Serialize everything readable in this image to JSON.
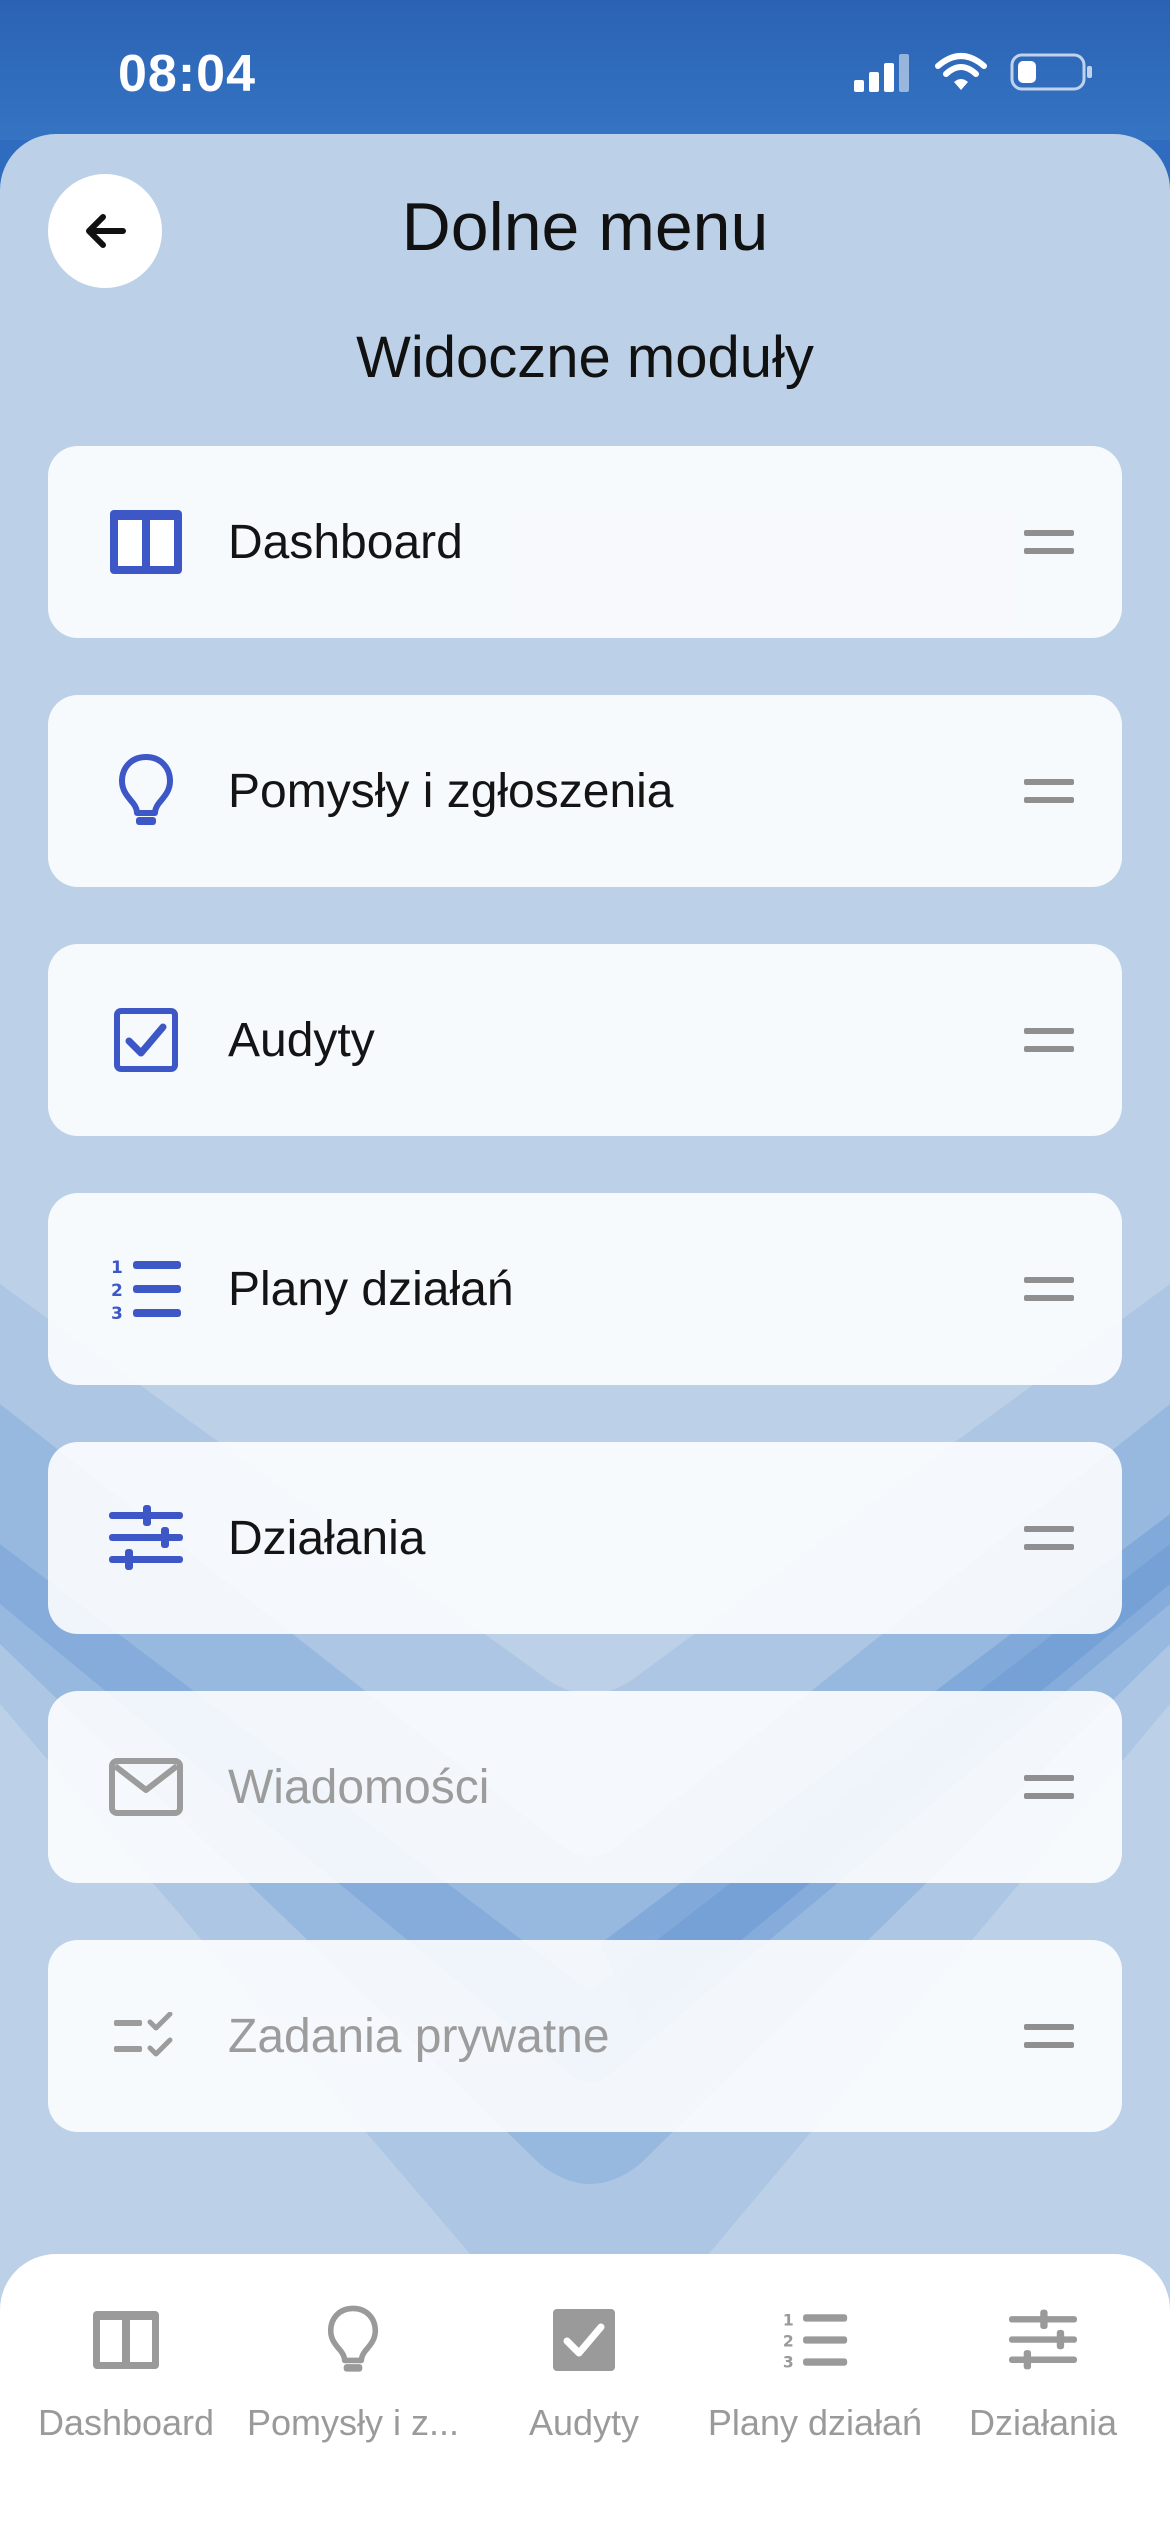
{
  "status_bar": {
    "time": "08:04",
    "icons": [
      "signal-icon",
      "wifi-icon",
      "battery-icon"
    ]
  },
  "header": {
    "back_icon": "arrow-left-icon",
    "title": "Dolne menu",
    "subtitle": "Widoczne moduły"
  },
  "modules": [
    {
      "label": "Dashboard",
      "icon": "dashboard-columns-icon",
      "enabled": true
    },
    {
      "label": "Pomysły i zgłoszenia",
      "icon": "lightbulb-icon",
      "enabled": true
    },
    {
      "label": "Audyty",
      "icon": "checkbox-icon",
      "enabled": true
    },
    {
      "label": "Plany działań",
      "icon": "numbered-list-icon",
      "enabled": true
    },
    {
      "label": "Działania",
      "icon": "sliders-icon",
      "enabled": true
    },
    {
      "label": "Wiadomości",
      "icon": "envelope-icon",
      "enabled": false
    },
    {
      "label": "Zadania prywatne",
      "icon": "checklist-icon",
      "enabled": false
    }
  ],
  "bottom_nav": [
    {
      "label": "Dashboard",
      "icon": "dashboard-columns-icon"
    },
    {
      "label": "Pomysły i z...",
      "icon": "lightbulb-icon"
    },
    {
      "label": "Audyty",
      "icon": "checkbox-icon"
    },
    {
      "label": "Plany działań",
      "icon": "numbered-list-icon"
    },
    {
      "label": "Działania",
      "icon": "sliders-icon"
    }
  ],
  "colors": {
    "accent": "#3d57c6",
    "disabled": "#9c9c9c",
    "panel_bg": "#bcd1e8",
    "status_bar_bg": "#2f6cc0"
  }
}
